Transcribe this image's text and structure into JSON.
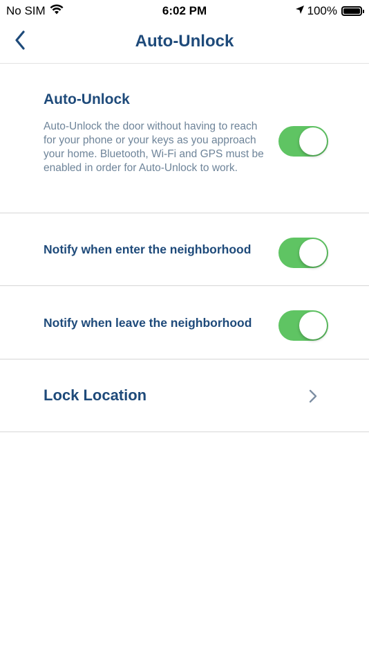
{
  "status_bar": {
    "carrier": "No SIM",
    "time": "6:02 PM",
    "battery": "100%"
  },
  "nav": {
    "title": "Auto-Unlock"
  },
  "main": {
    "title": "Auto-Unlock",
    "description": "Auto-Unlock the door without having to reach for your phone or your keys as you approach your home.  Bluetooth, Wi-Fi and GPS must be enabled in order for Auto-Unlock to work.",
    "enabled": true
  },
  "rows": {
    "enter": {
      "label": "Notify when enter the neighborhood",
      "enabled": true
    },
    "leave": {
      "label": "Notify when leave the neighborhood",
      "enabled": true
    },
    "location": {
      "label": "Lock Location"
    }
  },
  "colors": {
    "accent": "#1e4a7a",
    "toggle_on": "#5fc463",
    "description": "#6e8499"
  }
}
